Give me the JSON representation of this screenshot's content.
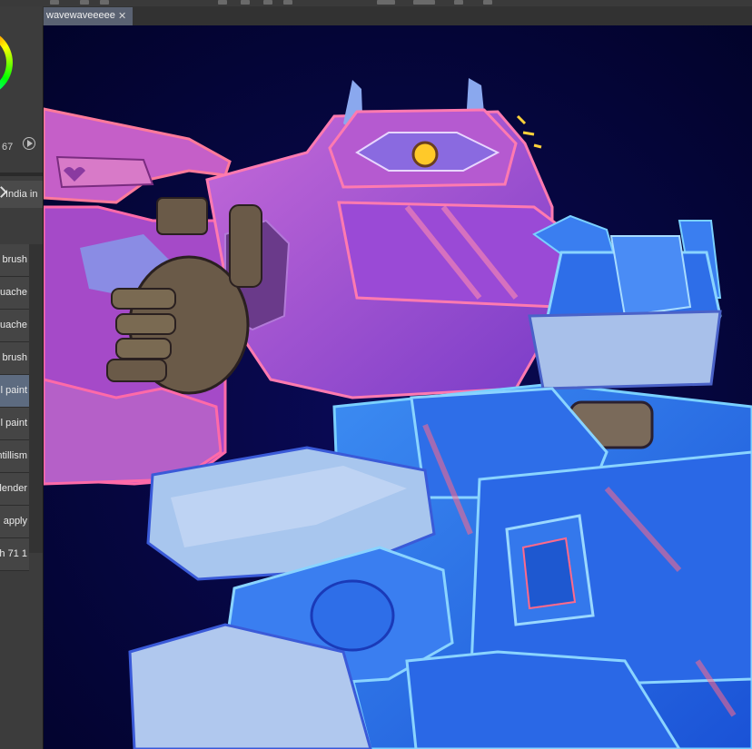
{
  "document_tab": {
    "title": "wavewaveeeee",
    "close_glyph": "✕"
  },
  "color_panel": {
    "value_readout": "67",
    "play_icon": "play-circle-icon"
  },
  "brush_settings": {
    "brush_name": "India in"
  },
  "subtools": [
    {
      "label": "brush"
    },
    {
      "label": "uache"
    },
    {
      "label": "uache"
    },
    {
      "label": "brush"
    },
    {
      "label": "il paint",
      "selected": true
    },
    {
      "label": "il paint"
    },
    {
      "label": "ntillism"
    },
    {
      "label": "lender"
    },
    {
      "label": "l apply"
    },
    {
      "label": "h 71 1"
    }
  ],
  "colors": {
    "canvas_bg": "#040532",
    "panel_bg": "#3c3c3c",
    "tab_active": "#5a6272",
    "selected_item": "#5d6b80"
  }
}
